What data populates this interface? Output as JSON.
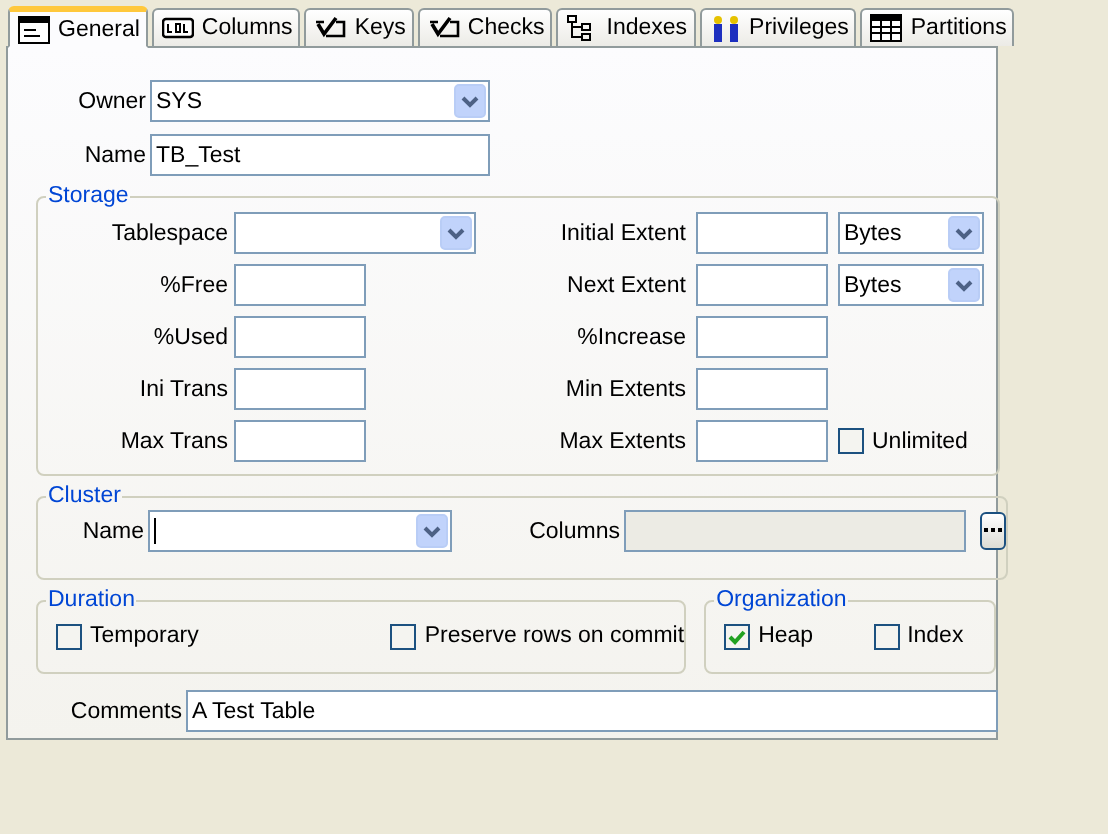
{
  "tabs": [
    {
      "label": "General",
      "kind": "form",
      "selected": true
    },
    {
      "label": "Columns",
      "kind": "columns",
      "selected": false
    },
    {
      "label": "Keys",
      "kind": "check",
      "selected": false
    },
    {
      "label": "Checks",
      "kind": "check",
      "selected": false
    },
    {
      "label": "Indexes",
      "kind": "tree",
      "selected": false
    },
    {
      "label": "Privileges",
      "kind": "people",
      "selected": false
    },
    {
      "label": "Partitions",
      "kind": "grid",
      "selected": false
    }
  ],
  "owner": {
    "label": "Owner",
    "value": "SYS"
  },
  "name": {
    "label": "Name",
    "value": "TB_Test"
  },
  "storage": {
    "title": "Storage",
    "left": [
      {
        "label": "Tablespace",
        "kind": "select"
      },
      {
        "label": "%Free",
        "kind": "input"
      },
      {
        "label": "%Used",
        "kind": "input"
      },
      {
        "label": "Ini Trans",
        "kind": "input"
      },
      {
        "label": "Max Trans",
        "kind": "input"
      }
    ],
    "right": [
      {
        "label": "Initial Extent",
        "kind": "unit",
        "unit": "Bytes"
      },
      {
        "label": "Next Extent",
        "kind": "unit",
        "unit": "Bytes"
      },
      {
        "label": "%Increase",
        "kind": "plain"
      },
      {
        "label": "Min Extents",
        "kind": "plain"
      },
      {
        "label": "Max Extents",
        "kind": "checkbox",
        "checkbox": {
          "label": "Unlimited",
          "checked": false
        }
      }
    ]
  },
  "cluster": {
    "title": "Cluster",
    "name_label": "Name",
    "columns_label": "Columns",
    "columns_disabled": true
  },
  "duration": {
    "title": "Duration",
    "options": [
      {
        "label": "Temporary",
        "checked": false
      },
      {
        "label": "Preserve rows on commit",
        "checked": false
      }
    ]
  },
  "organization": {
    "title": "Organization",
    "options": [
      {
        "label": "Heap",
        "checked": true
      },
      {
        "label": "Index",
        "checked": false
      }
    ]
  },
  "comments": {
    "label": "Comments",
    "value": "A Test Table"
  }
}
